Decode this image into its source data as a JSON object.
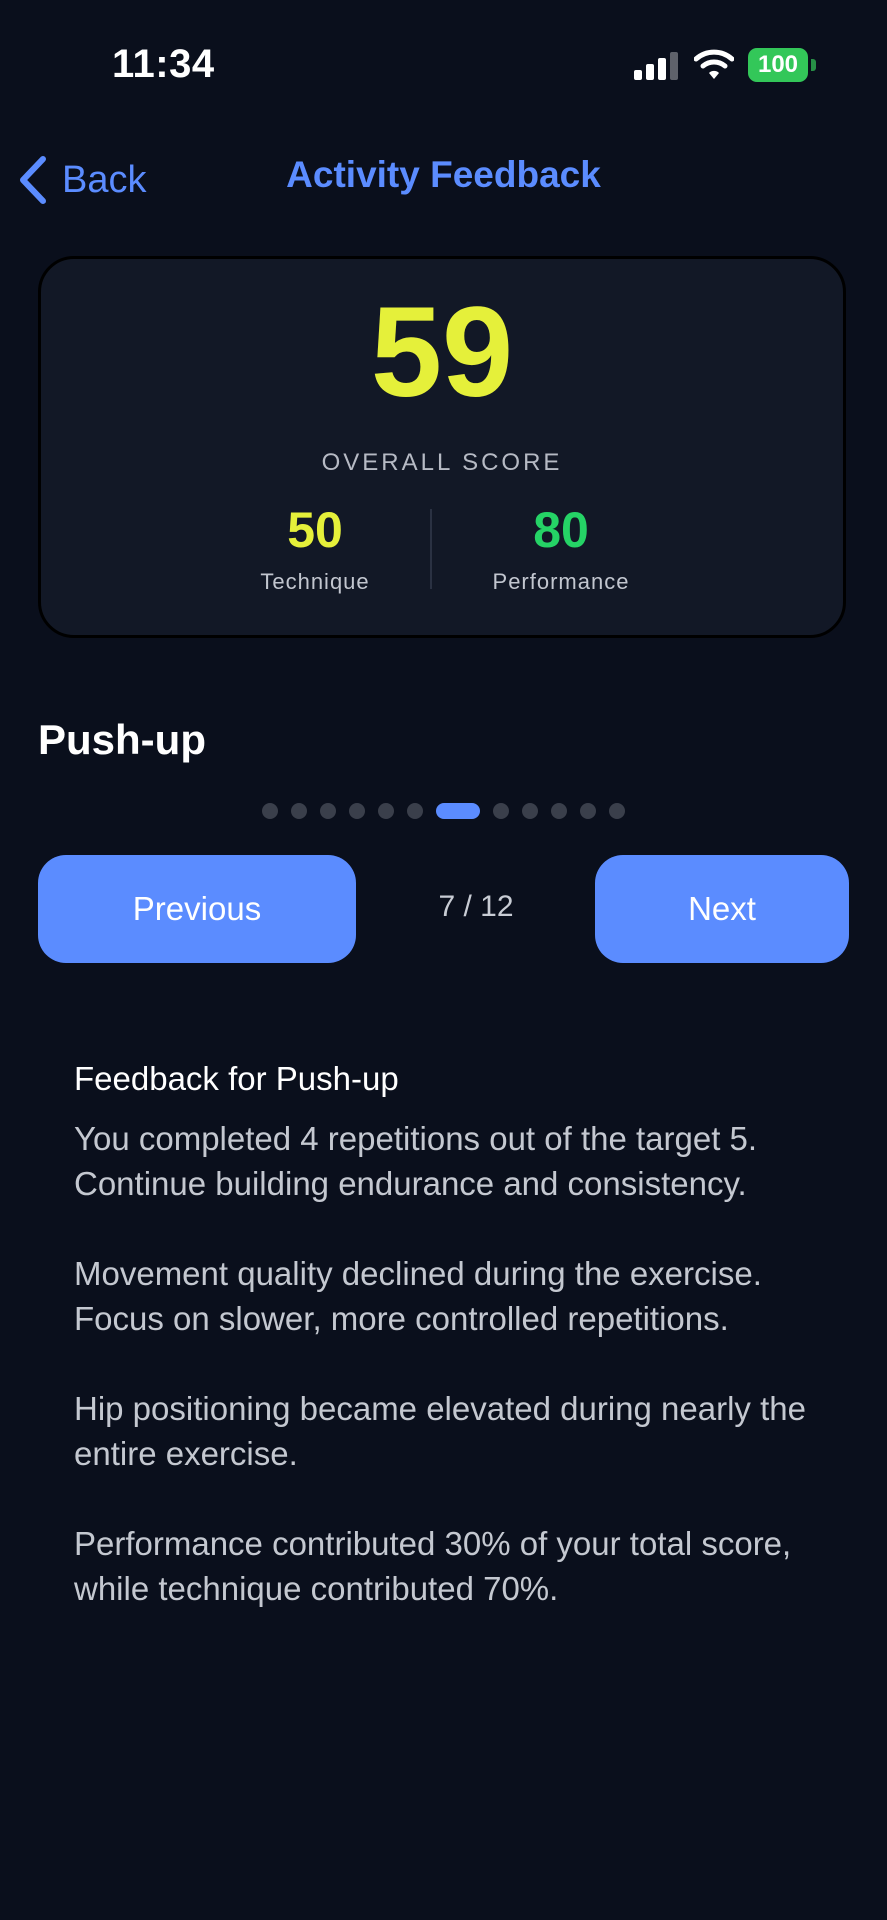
{
  "status_bar": {
    "time": "11:34",
    "battery": "100",
    "icons": [
      "signal-icon",
      "wifi-icon",
      "battery-icon"
    ]
  },
  "nav": {
    "back_label": "Back",
    "title": "Activity Feedback"
  },
  "score": {
    "overall_value": "59",
    "overall_label": "OVERALL SCORE",
    "technique_value": "50",
    "technique_label": "Technique",
    "performance_value": "80",
    "performance_label": "Performance"
  },
  "exercise": {
    "name": "Push-up",
    "total_pages": 12,
    "current_page": 7
  },
  "pager": {
    "previous_label": "Previous",
    "counter": "7 / 12",
    "next_label": "Next"
  },
  "feedback": {
    "title": "Feedback for Push-up",
    "paragraphs": [
      "You completed 4 repetitions out of the target 5. Continue building endurance and consistency.",
      "Movement quality declined during the exercise. Focus on slower, more controlled repetitions.",
      "Hip positioning became elevated during nearly the entire exercise.",
      "Performance contributed 30% of your total score, while technique contributed 70%."
    ]
  },
  "colors": {
    "background": "#0a0f1c",
    "accent": "#5b8cff",
    "score_yellow": "#e5f03a",
    "score_green": "#25d366",
    "battery_green": "#33c759"
  }
}
